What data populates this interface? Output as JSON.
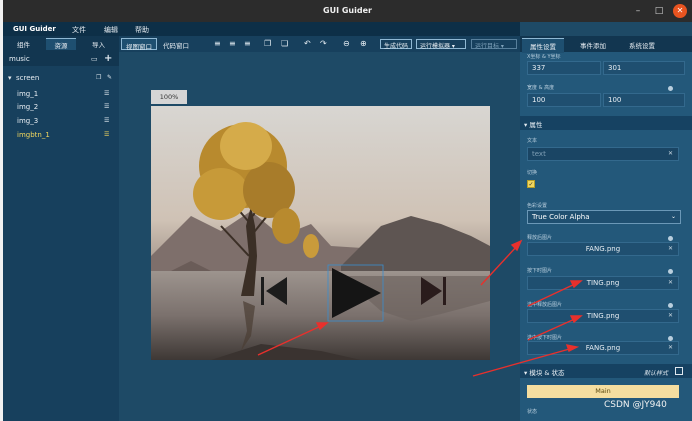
{
  "window": {
    "title": "GUI Guider"
  },
  "menu": {
    "app": "GUI Guider",
    "items": [
      "文件",
      "编辑",
      "帮助"
    ]
  },
  "left_tabs": [
    "组件",
    "资源",
    "导入"
  ],
  "project": {
    "name": "music"
  },
  "tree": {
    "screen": "screen",
    "children": [
      "img_1",
      "img_2",
      "img_3",
      "imgbtn_1"
    ]
  },
  "view_tabs": [
    "视图窗口",
    "代码窗口"
  ],
  "toolbar": {
    "generate_code": "生成代码",
    "run_simulator": "运行模拟器",
    "run_target": "运行目标"
  },
  "canvas": {
    "zoom": "100%"
  },
  "right_tabs": [
    "属性设置",
    "事件添加",
    "系统设置"
  ],
  "props": {
    "position_label": "X坐标 & Y坐标",
    "x": "337",
    "y": "301",
    "size_label": "宽度 & 高度",
    "width": "100",
    "height": "100",
    "attr_header": "属性",
    "text_label": "文本",
    "text_placeholder": "text",
    "toggle_label": "切换",
    "toggle_checked": "✓",
    "color_label": "色彩设置",
    "color_value": "True Color Alpha",
    "released_label": "释放后图片",
    "released_value": "FANG.png",
    "pressed_label": "按下时图片",
    "pressed_value": "TING.png",
    "checked_released_label": "选中释放后图片",
    "checked_released_value": "TING.png",
    "checked_pressed_label": "选中按下时图片",
    "checked_pressed_value": "FANG.png",
    "module_header": "模块 & 状态",
    "default_style": "默认样式",
    "main_btn": "Main",
    "state_label": "状态"
  },
  "watermark": "CSDN @JY940",
  "colors": {
    "accent": "#f1d65e",
    "panel": "#23587a",
    "arrow": "#e8302c"
  }
}
